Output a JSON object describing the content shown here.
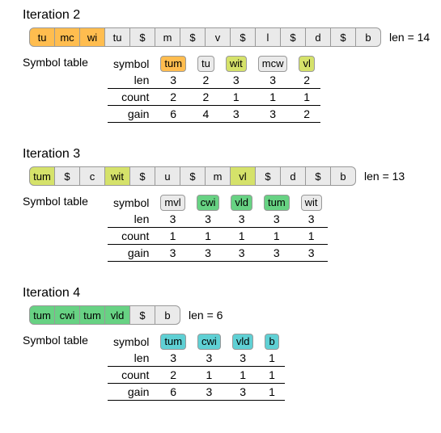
{
  "iterations": [
    {
      "title": "Iteration 2",
      "tokens": [
        [
          "tu",
          "orange"
        ],
        [
          "mc",
          "orange"
        ],
        [
          "wi",
          "orange"
        ],
        [
          "tu",
          ""
        ],
        [
          "$",
          ""
        ],
        [
          "m",
          ""
        ],
        [
          "$",
          ""
        ],
        [
          "v",
          ""
        ],
        [
          "$",
          ""
        ],
        [
          "l",
          ""
        ],
        [
          "$",
          ""
        ],
        [
          "d",
          ""
        ],
        [
          "$",
          ""
        ],
        [
          "b",
          ""
        ]
      ],
      "len": 14,
      "table": {
        "syms": [
          [
            "tum",
            "orange"
          ],
          [
            "tu",
            ""
          ],
          [
            "wit",
            "yellow"
          ],
          [
            "mcw",
            ""
          ],
          [
            "vl",
            "yellow"
          ]
        ],
        "rows": [
          [
            "len",
            3,
            2,
            3,
            3,
            2
          ],
          [
            "count",
            2,
            2,
            1,
            1,
            1
          ],
          [
            "gain",
            6,
            4,
            3,
            3,
            2
          ]
        ]
      }
    },
    {
      "title": "Iteration 3",
      "tokens": [
        [
          "tum",
          "yellow"
        ],
        [
          "$",
          ""
        ],
        [
          "c",
          ""
        ],
        [
          "wit",
          "yellow"
        ],
        [
          "$",
          ""
        ],
        [
          "u",
          ""
        ],
        [
          "$",
          ""
        ],
        [
          "m",
          ""
        ],
        [
          "vl",
          "yellow"
        ],
        [
          "$",
          ""
        ],
        [
          "d",
          ""
        ],
        [
          "$",
          ""
        ],
        [
          "b",
          ""
        ]
      ],
      "len": 13,
      "table": {
        "syms": [
          [
            "mvl",
            ""
          ],
          [
            "cwi",
            "green"
          ],
          [
            "vld",
            "green"
          ],
          [
            "tum",
            "green"
          ],
          [
            "wit",
            ""
          ]
        ],
        "rows": [
          [
            "len",
            3,
            3,
            3,
            3,
            3
          ],
          [
            "count",
            1,
            1,
            1,
            1,
            1
          ],
          [
            "gain",
            3,
            3,
            3,
            3,
            3
          ]
        ]
      }
    },
    {
      "title": "Iteration 4",
      "tokens": [
        [
          "tum",
          "green"
        ],
        [
          "cwi",
          "green"
        ],
        [
          "tum",
          "green"
        ],
        [
          "vld",
          "green"
        ],
        [
          "$",
          ""
        ],
        [
          "b",
          ""
        ]
      ],
      "len": 6,
      "table": {
        "syms": [
          [
            "tum",
            "cyan"
          ],
          [
            "cwi",
            "cyan"
          ],
          [
            "vld",
            "cyan"
          ],
          [
            "b",
            "cyan"
          ]
        ],
        "rows": [
          [
            "len",
            3,
            3,
            3,
            1
          ],
          [
            "count",
            2,
            1,
            1,
            1
          ],
          [
            "gain",
            6,
            3,
            3,
            1
          ]
        ]
      }
    }
  ],
  "labels": {
    "symtbl": "Symbol table",
    "len": "len = ",
    "symhdr": "symbol"
  }
}
